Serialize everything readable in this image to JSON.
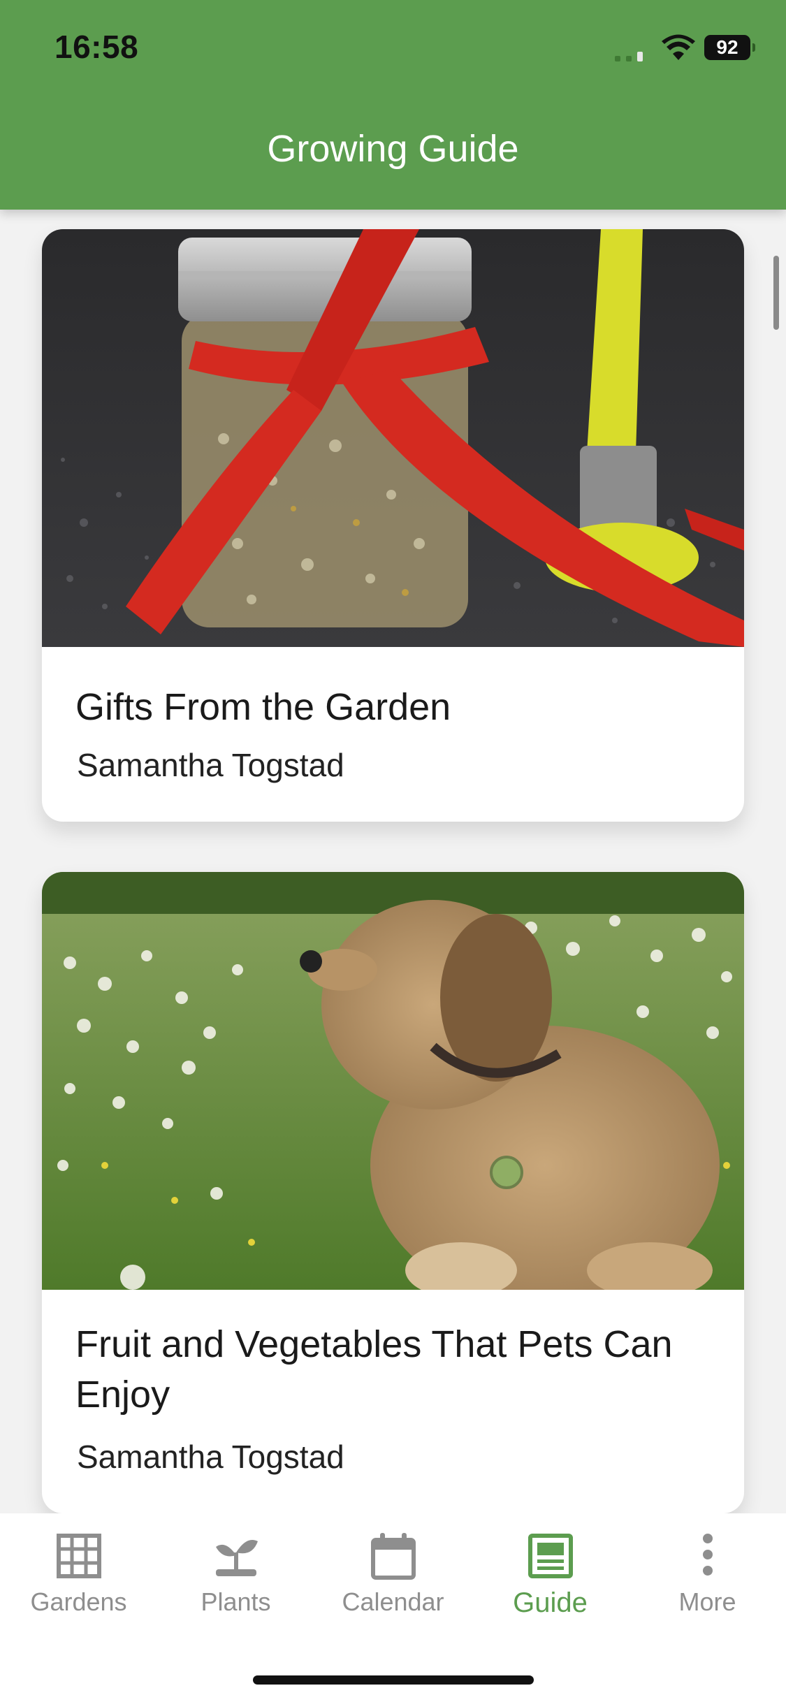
{
  "status_bar": {
    "time": "16:58",
    "battery": "92"
  },
  "header": {
    "title": "Growing Guide"
  },
  "articles": [
    {
      "title": "Gifts From the Garden",
      "author": "Samantha Togstad",
      "image": "jar-of-dried-herbs-with-red-ribbon-photo"
    },
    {
      "title": "Fruit and Vegetables That Pets Can Enjoy",
      "author": "Samantha Togstad",
      "image": "dog-in-clover-field-photo"
    }
  ],
  "tabs": [
    {
      "label": "Gardens",
      "icon": "grid-icon",
      "active": false
    },
    {
      "label": "Plants",
      "icon": "sprout-icon",
      "active": false
    },
    {
      "label": "Calendar",
      "icon": "calendar-icon",
      "active": false
    },
    {
      "label": "Guide",
      "icon": "guide-icon",
      "active": true
    },
    {
      "label": "More",
      "icon": "more-dots-icon",
      "active": false
    }
  ],
  "colors": {
    "primary_green": "#5c9d4f",
    "inactive_tab": "#8e8e8e",
    "background": "#f2f2f2"
  }
}
